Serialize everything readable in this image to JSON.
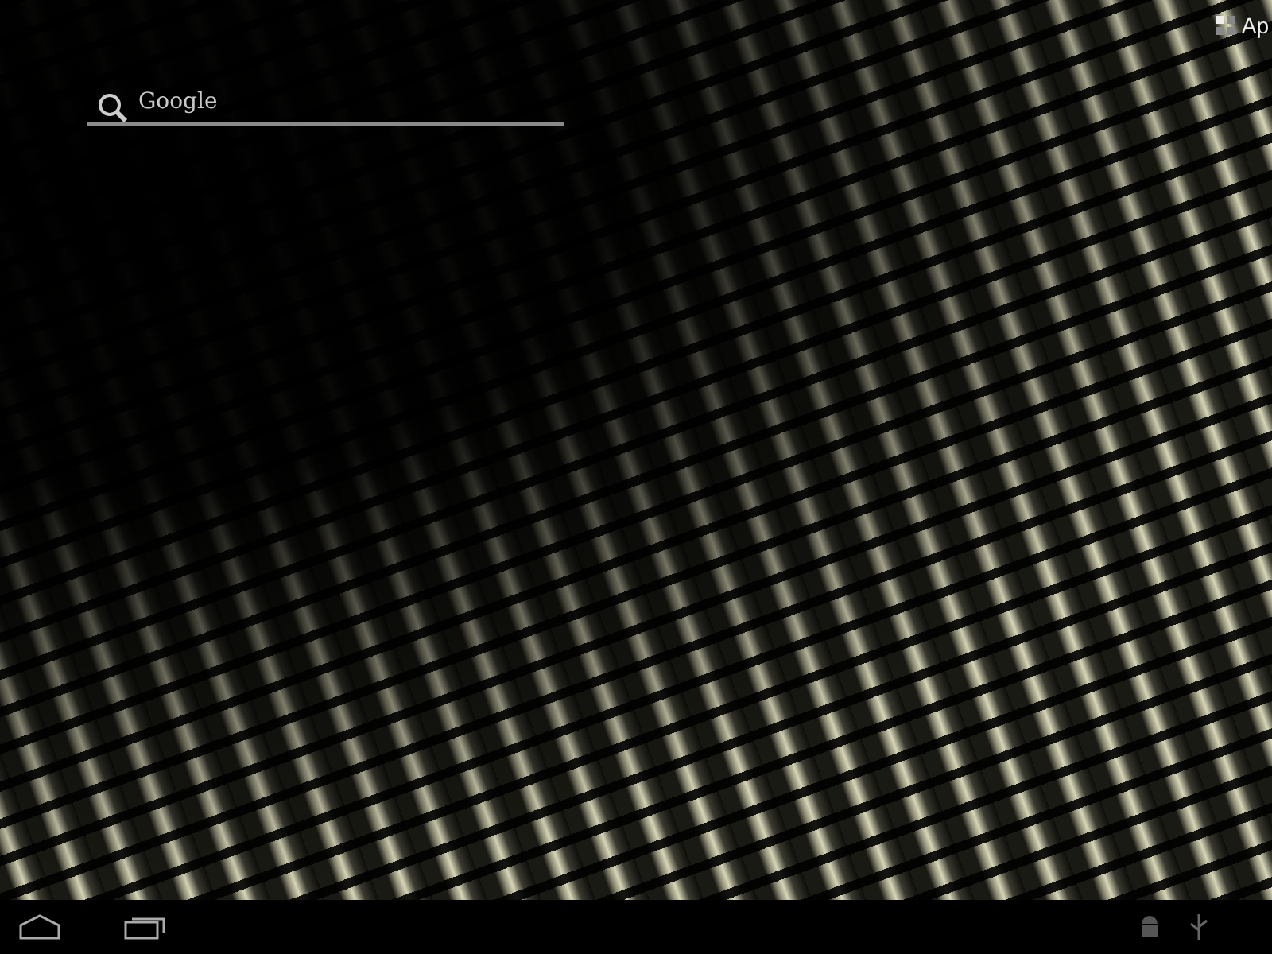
{
  "search": {
    "placeholder": "Google"
  },
  "apps_button": {
    "label": "Ap"
  }
}
